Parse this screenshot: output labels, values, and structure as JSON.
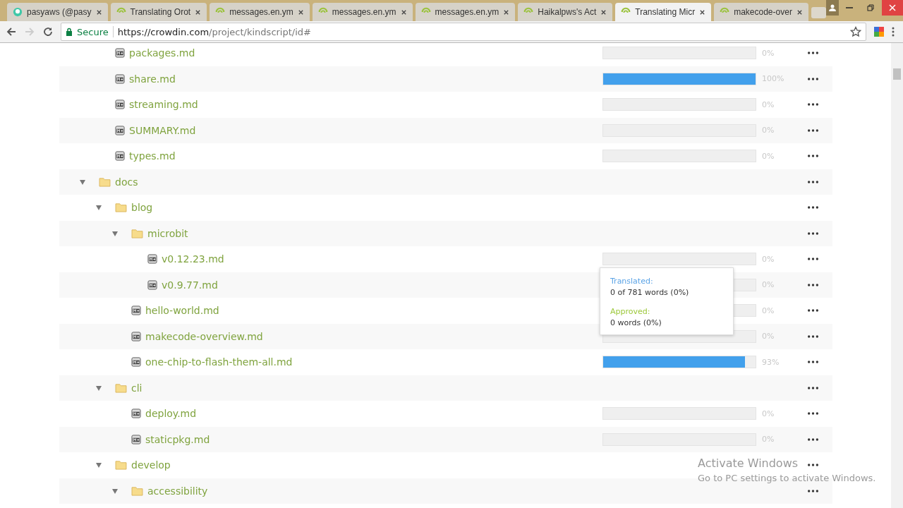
{
  "tabs": [
    {
      "title": "pasyaws (@pasy",
      "selected": false
    },
    {
      "title": "Translating Orot",
      "selected": false
    },
    {
      "title": "messages.en.ym",
      "selected": false
    },
    {
      "title": "messages.en.ym",
      "selected": false
    },
    {
      "title": "messages.en.ym",
      "selected": false
    },
    {
      "title": "Haikalpws's Act",
      "selected": false
    },
    {
      "title": "Translating Micr",
      "selected": true
    },
    {
      "title": "makecode-over",
      "selected": false
    }
  ],
  "address_bar": {
    "security": "Secure",
    "url_host": "https://crowdin.com",
    "url_path": "/project/kindscript/id#"
  },
  "tree": [
    {
      "kind": "continued",
      "children": [
        {
          "kind": "file",
          "name": "packages.md",
          "level": 0,
          "percent": "0%"
        },
        {
          "kind": "file",
          "name": "share.md",
          "level": 1,
          "percent": "100%"
        },
        {
          "kind": "file",
          "name": "streaming.md",
          "level": 0,
          "percent": "0%"
        },
        {
          "kind": "file",
          "name": "SUMMARY.md",
          "level": 0,
          "percent": "0%"
        },
        {
          "kind": "file",
          "name": "types.md",
          "level": 0,
          "percent": "0%"
        }
      ]
    },
    {
      "kind": "folder",
      "name": "docs",
      "expanded": true,
      "children": [
        {
          "kind": "folder",
          "name": "blog",
          "expanded": true,
          "children": [
            {
              "kind": "folder",
              "name": "microbit",
              "expanded": true,
              "children": [
                {
                  "kind": "file",
                  "name": "v0.12.23.md",
                  "level": 0,
                  "percent": "0%"
                },
                {
                  "kind": "file",
                  "name": "v0.9.77.md",
                  "level": 0,
                  "percent": "0%"
                }
              ]
            },
            {
              "kind": "file",
              "name": "hello-world.md",
              "level": 0,
              "percent": "0%"
            },
            {
              "kind": "file",
              "name": "makecode-overview.md",
              "level": 0,
              "percent": "0%"
            },
            {
              "kind": "file",
              "name": "one-chip-to-flash-them-all.md",
              "level": 0.93,
              "percent": "93%"
            }
          ]
        },
        {
          "kind": "folder",
          "name": "cli",
          "expanded": true,
          "children": [
            {
              "kind": "file",
              "name": "deploy.md",
              "level": 0,
              "percent": "0%"
            },
            {
              "kind": "file",
              "name": "staticpkg.md",
              "level": 0,
              "percent": "0%"
            }
          ]
        },
        {
          "kind": "folder",
          "name": "develop",
          "expanded": true,
          "children": [
            {
              "kind": "folder",
              "name": "accessibility",
              "expanded": true
            }
          ]
        }
      ]
    }
  ],
  "tooltip": {
    "translated_label": "Translated:",
    "translated_value": "0 of 781 words (0%)",
    "approved_label": "Approved:",
    "approved_value": "0 words (0%)"
  },
  "os_notice": {
    "title": "Activate Windows",
    "text": "Go to PC settings to activate Windows."
  }
}
